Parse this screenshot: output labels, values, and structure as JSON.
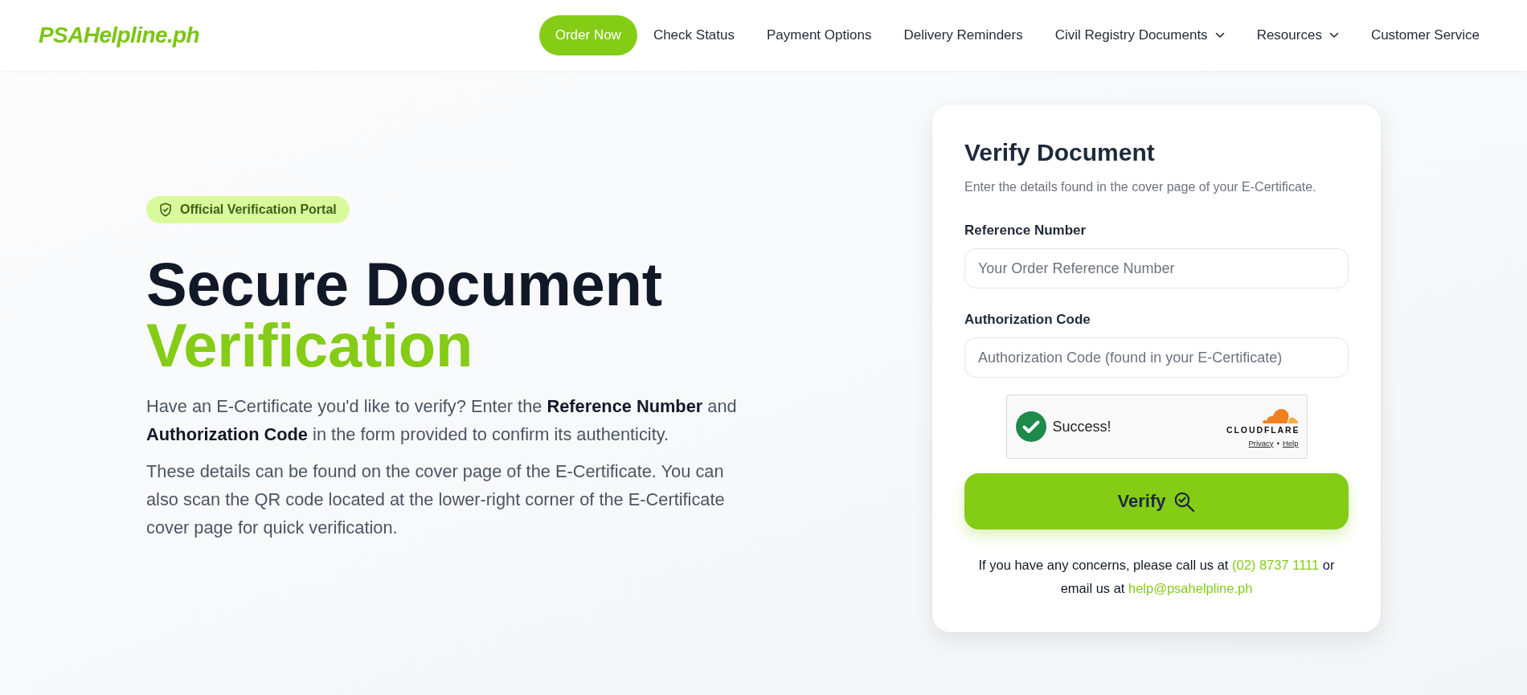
{
  "header": {
    "logo": "PSAHelpline.ph",
    "nav": [
      {
        "label": "Order Now",
        "kind": "button"
      },
      {
        "label": "Check Status",
        "kind": "link"
      },
      {
        "label": "Payment Options",
        "kind": "link"
      },
      {
        "label": "Delivery Reminders",
        "kind": "link"
      },
      {
        "label": "Civil Registry Documents",
        "kind": "dropdown"
      },
      {
        "label": "Resources",
        "kind": "dropdown"
      },
      {
        "label": "Customer Service",
        "kind": "link"
      }
    ]
  },
  "hero": {
    "badge": "Official Verification Portal",
    "title_line_1": "Secure Document",
    "title_line_2": "Verification",
    "paragraphs": [
      "Have an E-Certificate you'd like to verify? Enter the **Reference Number** and **Authorization Code** in the form provided to confirm its authenticity.",
      "These details can be found on the cover page of the E-Certificate. You can also scan the QR code located at the lower-right corner of the E-Certificate cover page for quick verification."
    ]
  },
  "verify_form": {
    "title": "Verify Document",
    "subtitle": "Enter the details found in the cover page of your E-Certificate.",
    "fields": [
      {
        "label": "Reference Number",
        "placeholder": "Your Order Reference Number"
      },
      {
        "label": "Authorization Code",
        "placeholder": "Authorization Code (found in your E-Certificate)"
      }
    ],
    "captcha": {
      "verified": true,
      "status": "Success!",
      "provider": "CLOUDFLARE",
      "links": [
        "Privacy",
        "Help"
      ],
      "separator": "•"
    },
    "submit_button": "Verify",
    "contact": {
      "text_1": "If you have any concerns, please call us at",
      "phone": "(02) 8737 1111",
      "text_2": "or email us at",
      "email": "help@psahelpline.ph"
    }
  }
}
